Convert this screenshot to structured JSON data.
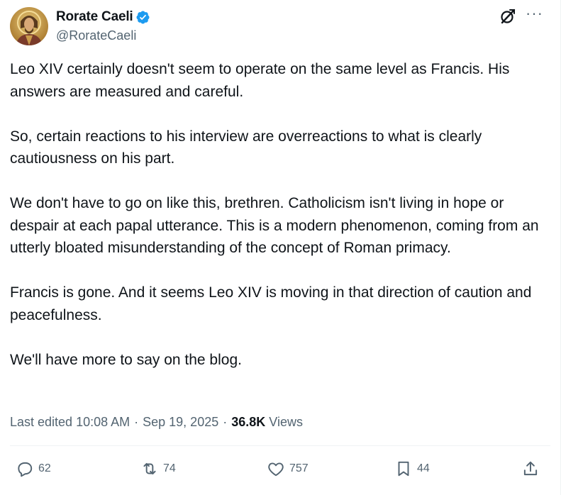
{
  "author": {
    "display_name": "Rorate Caeli",
    "handle": "@RorateCaeli",
    "verified": true
  },
  "tweet": {
    "paragraphs": [
      "Leo XIV certainly doesn't seem to operate on the same level as Francis. His answers are measured and careful.",
      "So, certain reactions to his interview are overreactions to what is clearly cautiousness on his part.",
      "We don't have to go on like this, brethren. Catholicism isn't living in hope or despair at each papal utterance. This is a modern phenomenon, coming from an utterly bloated misunderstanding of the concept of Roman primacy.",
      "Francis is gone. And it seems Leo XIV is moving in that direction of caution and peacefulness.",
      "We'll have more to say on the blog."
    ]
  },
  "meta": {
    "edited": "Last edited 10:08 AM",
    "separator": "·",
    "date": "Sep 19, 2025",
    "views_count": "36.8K",
    "views_label": "Views"
  },
  "actions": {
    "replies": "62",
    "reposts": "74",
    "likes": "757",
    "bookmarks": "44"
  },
  "colors": {
    "verified_badge": "#1d9bf0",
    "secondary_text": "#536471",
    "primary_text": "#0f1419"
  },
  "icons": [
    "grok-icon",
    "more-icon",
    "verified-badge-icon",
    "reply-icon",
    "repost-icon",
    "like-icon",
    "bookmark-icon",
    "share-icon"
  ]
}
